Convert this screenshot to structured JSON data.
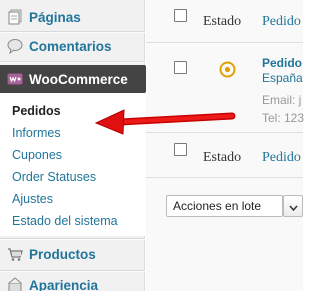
{
  "sidebar": {
    "paginas": "Páginas",
    "comentarios": "Comentarios",
    "woocommerce": "WooCommerce",
    "submenu": [
      "Pedidos",
      "Informes",
      "Cupones",
      "Order Statuses",
      "Ajustes",
      "Estado del sistema"
    ],
    "productos": "Productos",
    "apariencia": "Apariencia"
  },
  "table": {
    "col_estado": "Estado",
    "col_pedido": "Pedido",
    "order": {
      "title": "Pedido",
      "country": "España",
      "email": "Email: j",
      "tel": "Tel: 123"
    }
  },
  "bulk": {
    "label": "Acciones en lote"
  },
  "colors": {
    "link": "#21759b",
    "active_bg": "#444444",
    "arrow": "#e01010",
    "status_icon": "#e2a000"
  }
}
